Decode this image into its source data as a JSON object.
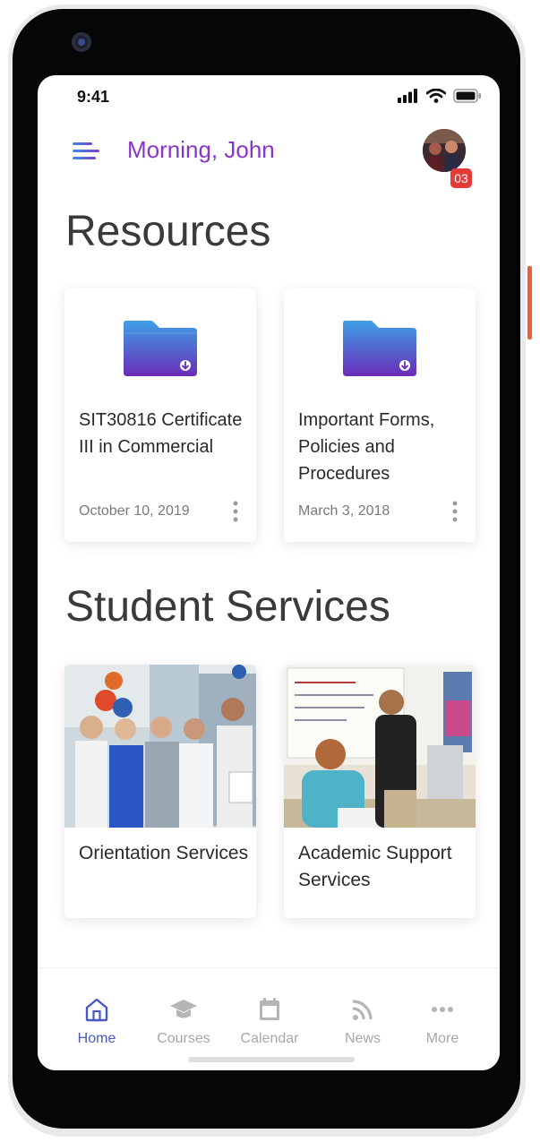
{
  "status_bar": {
    "time": "9:41"
  },
  "header": {
    "greeting": "Morning, John",
    "notification_count": "03"
  },
  "resources": {
    "title": "Resources",
    "items": [
      {
        "title": "SIT30816 Certificate III in Commercial",
        "date": "October 10, 2019"
      },
      {
        "title": "Important Forms, Policies and Procedures",
        "date": "March 3, 2018"
      }
    ]
  },
  "student_services": {
    "title": "Student Services",
    "items": [
      {
        "title": "Orientation Services"
      },
      {
        "title": "Academic Support Services"
      }
    ]
  },
  "bottom_nav": {
    "items": [
      {
        "label": "Home",
        "icon": "home-icon"
      },
      {
        "label": "Courses",
        "icon": "graduation-cap-icon"
      },
      {
        "label": "Calendar",
        "icon": "calendar-icon"
      },
      {
        "label": "News",
        "icon": "rss-icon"
      },
      {
        "label": "More",
        "icon": "more-dots-icon"
      }
    ]
  },
  "colors": {
    "greeting": "#8a35c8",
    "active_nav": "#4a59c2",
    "badge": "#e53a3a",
    "folder_top": "#3fa0e6",
    "folder_bottom": "#6a2cb8"
  }
}
